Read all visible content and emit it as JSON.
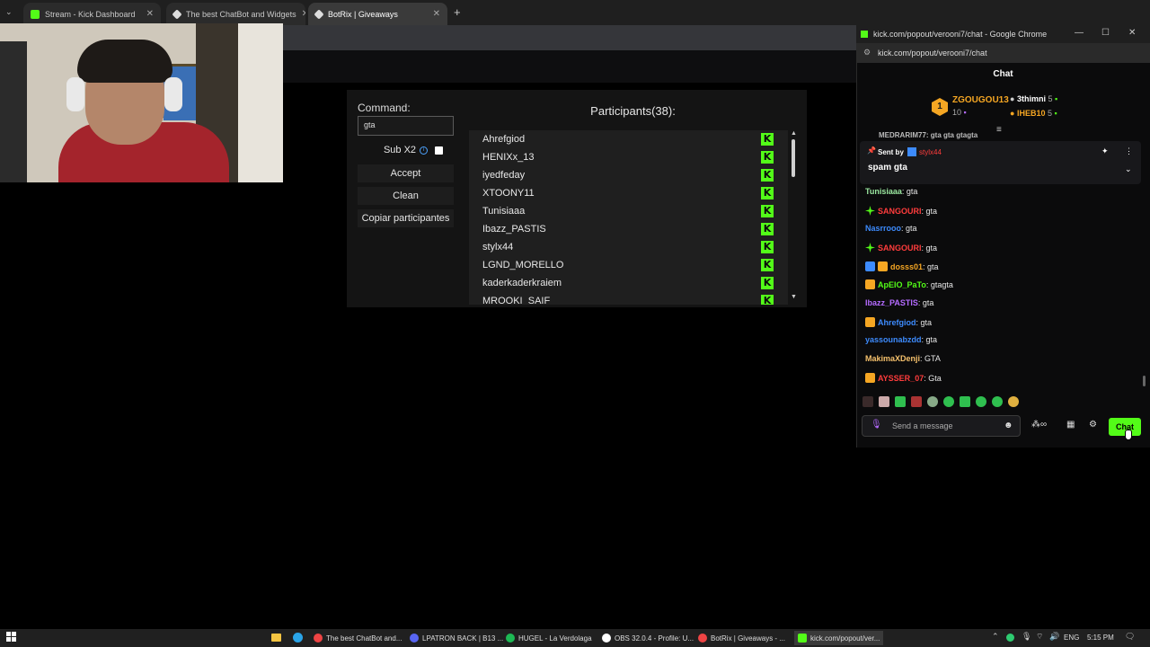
{
  "back_browser": {
    "tabs": [
      {
        "label": "Stream - Kick Dashboard"
      },
      {
        "label": "The best ChatBot and Widgets"
      },
      {
        "label": "BotRix | Giveaways"
      }
    ]
  },
  "giveaway": {
    "command_label": "Command:",
    "command_value": "gta",
    "sub_x2_label": "Sub X2",
    "accept_label": "Accept",
    "clean_label": "Clean",
    "copy_label": "Copiar participantes",
    "participants_title": "Participants(38):",
    "participants": [
      "Ahrefgiod",
      "HENIXx_13",
      "iyedfeday",
      "XTOONY11",
      "Tunisiaaa",
      "Ibazz_PASTIS",
      "stylx44",
      "LGND_MORELLO",
      "kaderkaderkraiem",
      "MROOKI_SAIF"
    ]
  },
  "chat_window": {
    "title": "kick.com/popout/verooni7/chat - Google Chrome",
    "url": "kick.com/popout/verooni7/chat",
    "header": "Chat",
    "leaderboard": {
      "top": {
        "rank": "1",
        "name": "ZGOUGOU13",
        "count": "10"
      },
      "others": [
        {
          "name": "3thimni",
          "count": "5"
        },
        {
          "name": "IHEB10",
          "count": "5"
        }
      ]
    },
    "pinned": {
      "top_line": "MEDRARIM77: gta gta gtagta",
      "sent_by_label": "Sent by",
      "sent_by_user": "stylx44",
      "text": "spam gta"
    },
    "messages": [
      {
        "user": "Tunisiaaa",
        "text": ": gta",
        "color": "#9be8a0"
      },
      {
        "user": "SANGOURI",
        "text": ": gta",
        "color": "#ff3c3c"
      },
      {
        "user": "Nasrrooo",
        "text": ": gta",
        "color": "#3d8bfd"
      },
      {
        "user": "SANGOURI",
        "text": ": gta",
        "color": "#ff3c3c"
      },
      {
        "user": "dosss01",
        "text": ": gta",
        "color": "#f5a623"
      },
      {
        "user": "ApEIO_PaTo",
        "text": ": gtagta",
        "color": "#53fc18"
      },
      {
        "user": "Ibazz_PASTIS",
        "text": ": gta",
        "color": "#b46bff"
      },
      {
        "user": "Ahrefgiod",
        "text": ": gta",
        "color": "#3d8bfd"
      },
      {
        "user": "yassounabzdd",
        "text": ": gta",
        "color": "#3d8bfd"
      },
      {
        "user": "MakimaXDenji",
        "text": ": GTA",
        "color": "#f5c16c"
      },
      {
        "user": "AYSSER_07",
        "text": ": Gta",
        "color": "#ff3c3c"
      }
    ],
    "input_placeholder": "Send a message",
    "chat_button": "Chat"
  },
  "taskbar": {
    "items": [
      {
        "label": "The best ChatBot and..."
      },
      {
        "label": "LPATRON BACK | B13 ..."
      },
      {
        "label": "HUGEL - La Verdolaga"
      },
      {
        "label": "OBS 32.0.4 - Profile: U..."
      },
      {
        "label": "BotRix | Giveaways - ..."
      },
      {
        "label": "kick.com/popout/ver..."
      }
    ],
    "lang": "ENG",
    "time": "5:15 PM"
  },
  "colors": {
    "kick_green": "#53fc18",
    "accent_orange": "#f5a623"
  }
}
